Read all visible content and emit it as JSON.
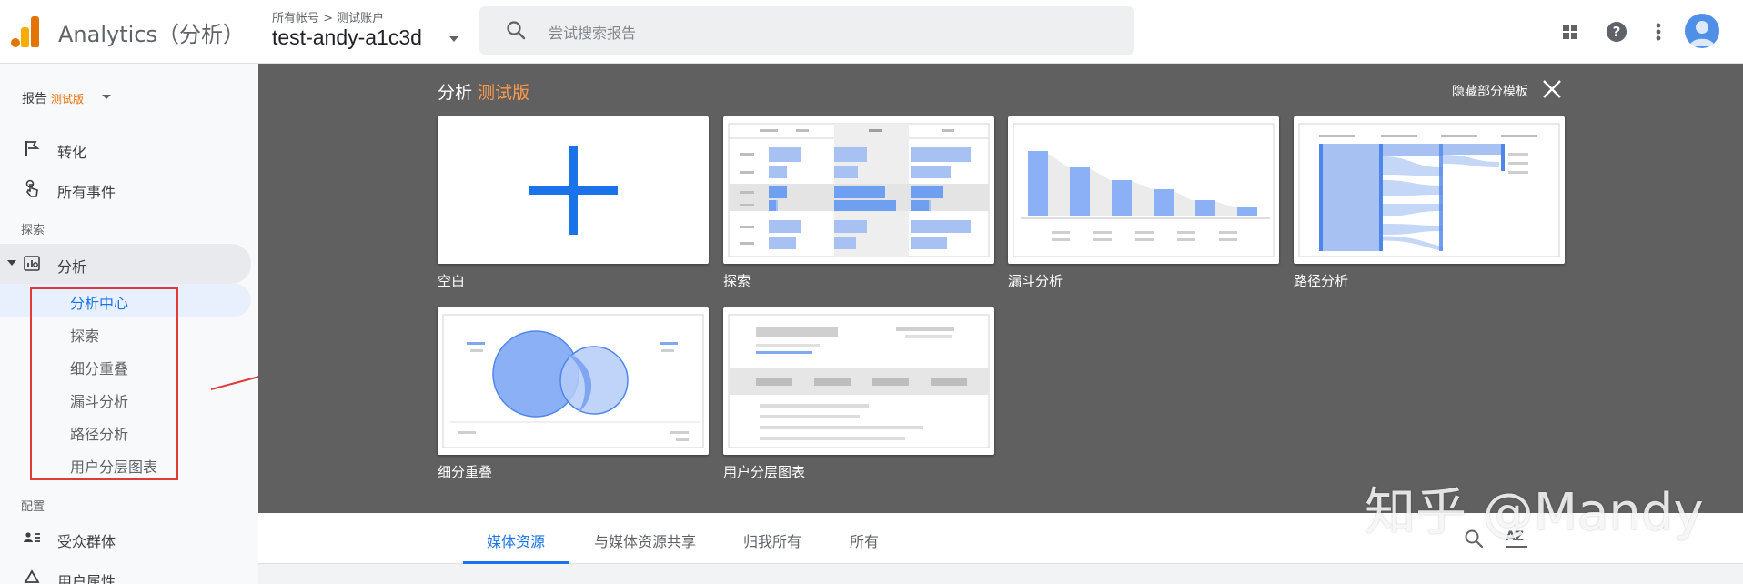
{
  "header": {
    "app_title": "Analytics（分析）",
    "breadcrumb": "所有帐号 > 测试账户",
    "account_name": "test-andy-a1c3d",
    "search_placeholder": "尝试搜索报告",
    "icons": [
      "apps-icon",
      "help-icon",
      "more-vert-icon",
      "account-avatar"
    ]
  },
  "sidebar": {
    "report_label": "报告",
    "report_badge": "测试版",
    "items_top": [
      {
        "label": "转化",
        "icon": "flag-icon"
      },
      {
        "label": "所有事件",
        "icon": "touch-icon"
      }
    ],
    "section_explore": "探索",
    "analysis": {
      "label": "分析",
      "icon": "analysis-icon"
    },
    "analysis_subitems": [
      "分析中心",
      "探索",
      "细分重叠",
      "漏斗分析",
      "路径分析",
      "用户分层图表"
    ],
    "section_config": "配置",
    "items_bottom": [
      {
        "label": "受众群体",
        "icon": "audience-icon"
      },
      {
        "label": "用户属性",
        "icon": "user-property-icon"
      }
    ]
  },
  "panel": {
    "title": "分析",
    "title_badge": "测试版",
    "hide_label": "隐藏部分模板",
    "templates": [
      {
        "label": "空白",
        "kind": "blank"
      },
      {
        "label": "探索",
        "kind": "explore"
      },
      {
        "label": "漏斗分析",
        "kind": "funnel"
      },
      {
        "label": "路径分析",
        "kind": "path"
      },
      {
        "label": "细分重叠",
        "kind": "overlap"
      },
      {
        "label": "用户分层图表",
        "kind": "cohort"
      }
    ]
  },
  "tabs": {
    "items": [
      "媒体资源",
      "与媒体资源共享",
      "归我所有",
      "所有"
    ],
    "active": "媒体资源",
    "sort_label": "AZ"
  },
  "watermark": "知乎 @Mandy",
  "colors": {
    "accent": "#1a73e8",
    "beta_orange": "#e8710a",
    "panel_bg": "#606060",
    "annotation_red": "#e03b3b"
  }
}
